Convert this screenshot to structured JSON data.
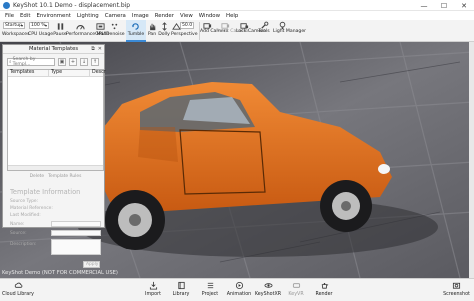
{
  "window": {
    "title": "KeyShot 10.1 Demo - displacement.bip",
    "controls": [
      "minimize",
      "maximize",
      "close"
    ]
  },
  "menu": [
    "File",
    "Edit",
    "Environment",
    "Lighting",
    "Camera",
    "Image",
    "Render",
    "View",
    "Window",
    "Help"
  ],
  "toolbar": {
    "workspace_value": "Startup",
    "zoom_value": "100 %",
    "threads_value": "20",
    "fov_value": "50.0",
    "labels": {
      "workspaces": "Workspaces",
      "cpu_usage": "CPU Usage",
      "pause": "Pause",
      "performance_mode": "Performance Mode",
      "gpu": "GPU",
      "denoise": "Denoise",
      "tumble": "Tumble",
      "pan": "Pan",
      "dolly": "Dolly",
      "perspective": "Perspective",
      "add_camera": "Add Camera",
      "reset_camera": "Reset Camera",
      "lock_camera": "Lock Camera",
      "tools": "Tools",
      "light_manager": "Light Manager"
    },
    "icons": {
      "tumble": "rotate-icon",
      "pan": "hand-icon",
      "dolly": "dolly-icon",
      "perspective": "perspective-icon",
      "add_camera": "camera-plus-icon",
      "reset_camera": "camera-reset-icon",
      "lock_camera": "camera-lock-icon",
      "tools": "wrench-icon",
      "light_manager": "bulb-icon"
    }
  },
  "viewport": {
    "watermark": "KeyShot Demo (NOT FOR COMMERCIAL USE)"
  },
  "material_templates": {
    "title": "Material Templates",
    "search_placeholder": "Search by Templ...",
    "columns": [
      "Templates",
      "Type",
      "Descr"
    ],
    "actions": [
      "Delete",
      "Template Rules"
    ],
    "info_title": "Template Information",
    "info_fields": [
      "Source Type:",
      "Material Reference:",
      "Last Modified:",
      "Name:",
      "Source:",
      "Description:"
    ],
    "apply_label": "Apply"
  },
  "bottombar": {
    "items": [
      {
        "label": "Cloud Library",
        "icon": "cloud-icon"
      },
      {
        "label": "Import",
        "icon": "import-icon"
      },
      {
        "label": "Library",
        "icon": "book-icon"
      },
      {
        "label": "Project",
        "icon": "list-icon"
      },
      {
        "label": "Animation",
        "icon": "animation-icon"
      },
      {
        "label": "KeyShotXR",
        "icon": "xr-icon"
      },
      {
        "label": "KeyVR",
        "icon": "vr-icon"
      },
      {
        "label": "Render",
        "icon": "teapot-icon"
      },
      {
        "label": "Screenshot",
        "icon": "screenshot-icon"
      }
    ]
  },
  "colors": {
    "car_body": "#e8731e",
    "accent": "#3b8ad6",
    "stone": "#6b6b70"
  }
}
